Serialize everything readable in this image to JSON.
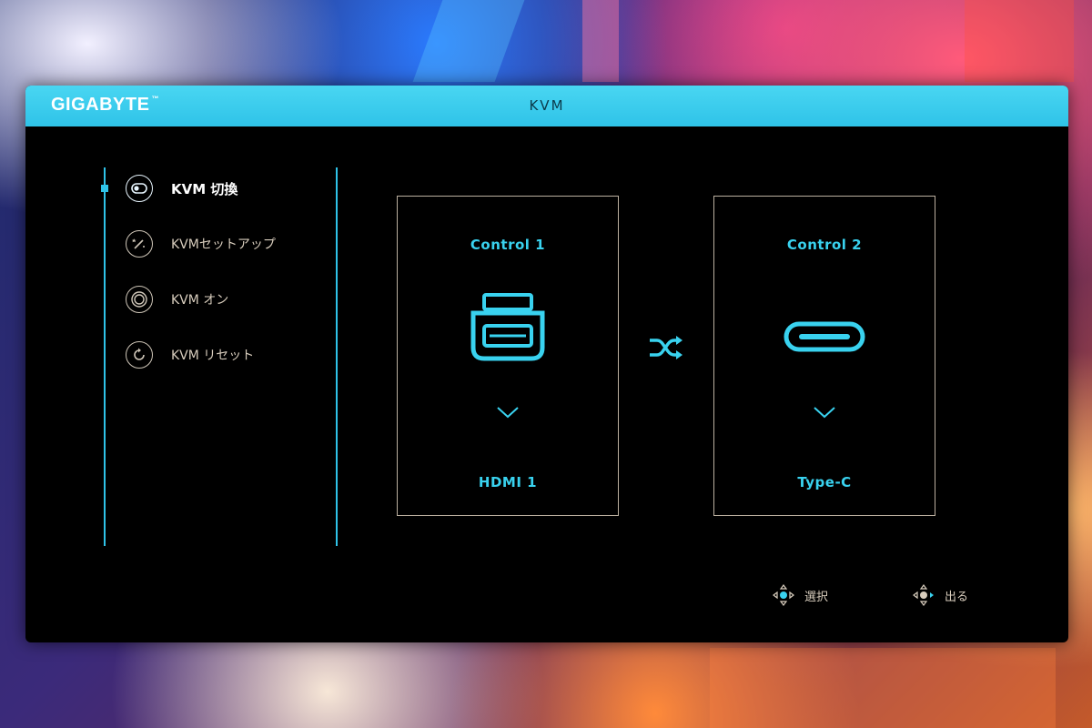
{
  "osd": {
    "brand": "GIGABYTE",
    "trademark": "™",
    "title": "KVM"
  },
  "sidebar": {
    "items": [
      {
        "label": "KVM 切換",
        "icon": "toggle-switch-icon",
        "active": true
      },
      {
        "label": "KVMセットアップ",
        "icon": "magic-wand-icon",
        "active": false
      },
      {
        "label": "KVM オン",
        "icon": "power-ring-icon",
        "active": false
      },
      {
        "label": "KVM リセット",
        "icon": "reset-icon",
        "active": false
      }
    ]
  },
  "controls": [
    {
      "title": "Control 1",
      "port": "HDMI 1",
      "icon": "usb-b-port-icon"
    },
    {
      "title": "Control 2",
      "port": "Type-C",
      "icon": "usb-c-port-icon"
    }
  ],
  "swap_icon": "shuffle-icon",
  "hints": [
    {
      "label": "選択",
      "icon": "joystick-select-icon"
    },
    {
      "label": "出る",
      "icon": "joystick-exit-icon"
    }
  ],
  "colors": {
    "accent": "#2fc3e8",
    "text_muted": "#d8cdbd",
    "panel_bg": "#000000"
  }
}
